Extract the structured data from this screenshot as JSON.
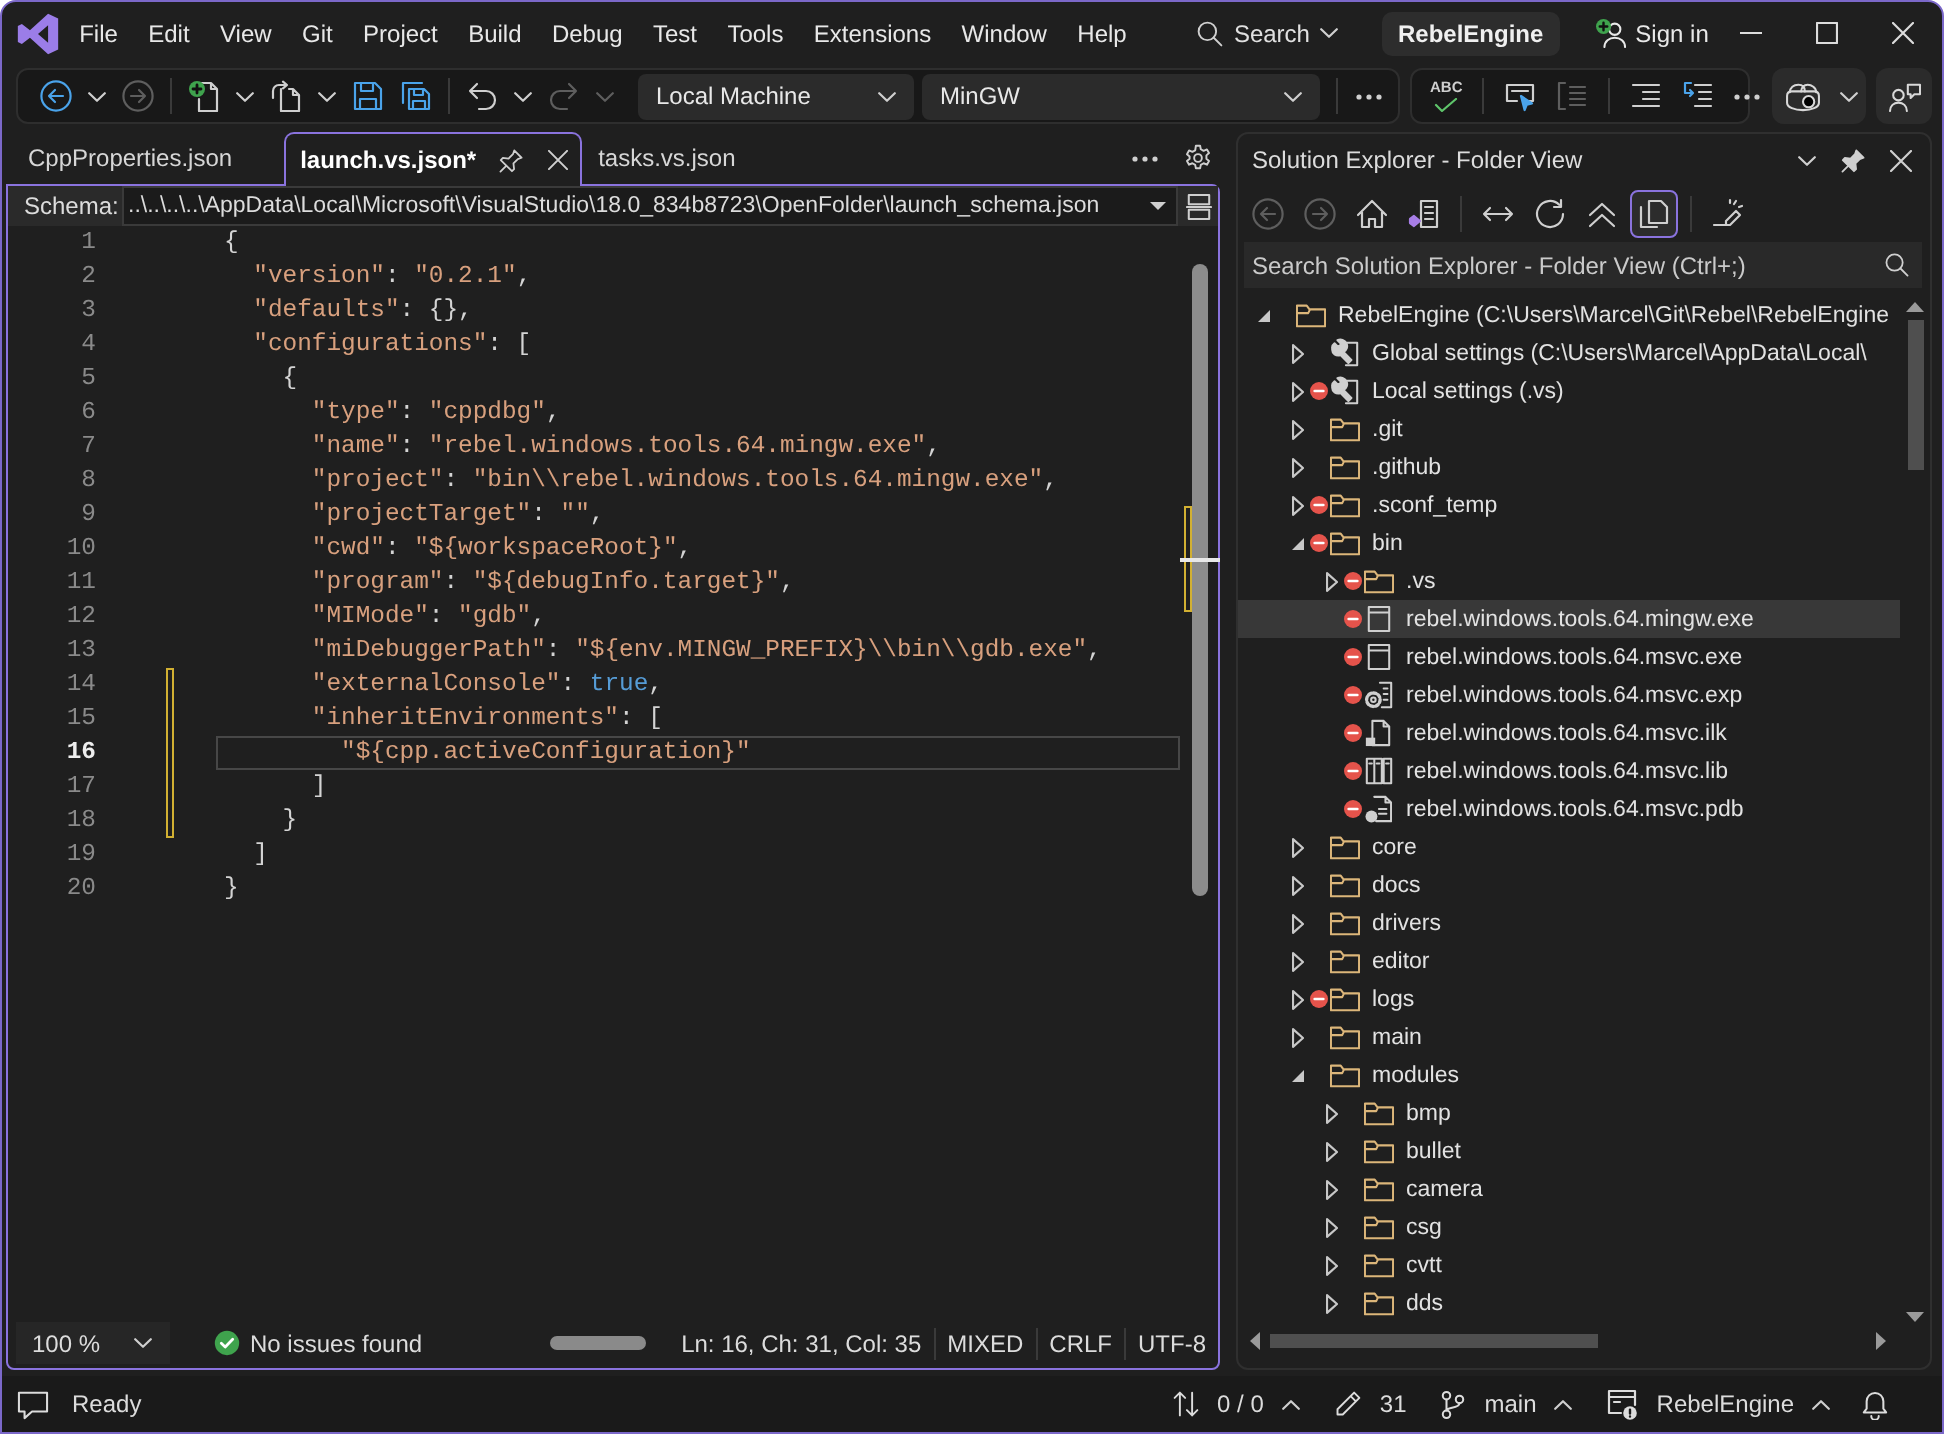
{
  "title_bar": {
    "menu": [
      "File",
      "Edit",
      "View",
      "Git",
      "Project",
      "Build",
      "Debug",
      "Test",
      "Tools",
      "Extensions",
      "Window",
      "Help"
    ],
    "search": "Search",
    "solution": "RebelEngine",
    "sign_in": "Sign in"
  },
  "toolbar": {
    "buttons": [
      {
        "kind": "back",
        "disabled": false
      },
      {
        "kind": "forward",
        "disabled": true
      },
      {
        "kind": "separator"
      },
      {
        "kind": "new",
        "disabled": false
      },
      {
        "kind": "open",
        "disabled": false
      },
      {
        "kind": "save",
        "disabled": false
      },
      {
        "kind": "save_all",
        "disabled": false
      },
      {
        "kind": "separator"
      },
      {
        "kind": "undo",
        "disabled": false
      },
      {
        "kind": "redo",
        "disabled": true
      }
    ],
    "target": "Local Machine",
    "configuration": "MinGW",
    "text_tools": [
      {
        "kind": "spelling",
        "label": "ABC",
        "disabled": false
      },
      {
        "kind": "separator"
      },
      {
        "kind": "comment",
        "disabled": false
      },
      {
        "kind": "uncomment",
        "disabled": true
      },
      {
        "kind": "separator"
      },
      {
        "kind": "indent",
        "disabled": false
      },
      {
        "kind": "wrap",
        "disabled": false
      }
    ]
  },
  "editor": {
    "tabs": [
      {
        "label": "CppProperties.json",
        "selected": false
      },
      {
        "label": "launch.vs.json*",
        "selected": true
      },
      {
        "label": "tasks.vs.json",
        "selected": false
      }
    ],
    "schema": {
      "label": "Schema:",
      "path": "..\\..\\..\\..\\AppData\\Local\\Microsoft\\VisualStudio\\18.0_834b8723\\OpenFolder\\launch_schema.json"
    },
    "lines": [
      {
        "number": "1",
        "current": false,
        "changed": false,
        "tokens": [
          {
            "kind": "punct",
            "text": "{"
          }
        ]
      },
      {
        "number": "2",
        "current": false,
        "changed": false,
        "tokens": [
          {
            "kind": "key",
            "text": "  \"version\""
          },
          {
            "kind": "punct",
            "text": ": "
          },
          {
            "kind": "string",
            "text": "\"0.2.1\""
          },
          {
            "kind": "punct",
            "text": ","
          }
        ]
      },
      {
        "number": "3",
        "current": false,
        "changed": false,
        "tokens": [
          {
            "kind": "key",
            "text": "  \"defaults\""
          },
          {
            "kind": "punct",
            "text": ": {},"
          }
        ]
      },
      {
        "number": "4",
        "current": false,
        "changed": false,
        "tokens": [
          {
            "kind": "key",
            "text": "  \"configurations\""
          },
          {
            "kind": "punct",
            "text": ": ["
          }
        ]
      },
      {
        "number": "5",
        "current": false,
        "changed": false,
        "tokens": [
          {
            "kind": "punct",
            "text": "    {"
          }
        ]
      },
      {
        "number": "6",
        "current": false,
        "changed": false,
        "tokens": [
          {
            "kind": "key",
            "text": "      \"type\""
          },
          {
            "kind": "punct",
            "text": ": "
          },
          {
            "kind": "string",
            "text": "\"cppdbg\""
          },
          {
            "kind": "punct",
            "text": ","
          }
        ]
      },
      {
        "number": "7",
        "current": false,
        "changed": false,
        "tokens": [
          {
            "kind": "key",
            "text": "      \"name\""
          },
          {
            "kind": "punct",
            "text": ": "
          },
          {
            "kind": "string",
            "text": "\"rebel.windows.tools.64.mingw.exe\""
          },
          {
            "kind": "punct",
            "text": ","
          }
        ]
      },
      {
        "number": "8",
        "current": false,
        "changed": false,
        "tokens": [
          {
            "kind": "key",
            "text": "      \"project\""
          },
          {
            "kind": "punct",
            "text": ": "
          },
          {
            "kind": "string",
            "text": "\"bin\\\\rebel.windows.tools.64.mingw.exe\""
          },
          {
            "kind": "punct",
            "text": ","
          }
        ]
      },
      {
        "number": "9",
        "current": false,
        "changed": false,
        "tokens": [
          {
            "kind": "key",
            "text": "      \"projectTarget\""
          },
          {
            "kind": "punct",
            "text": ": "
          },
          {
            "kind": "string",
            "text": "\"\""
          },
          {
            "kind": "punct",
            "text": ","
          }
        ]
      },
      {
        "number": "10",
        "current": false,
        "changed": false,
        "tokens": [
          {
            "kind": "key",
            "text": "      \"cwd\""
          },
          {
            "kind": "punct",
            "text": ": "
          },
          {
            "kind": "string",
            "text": "\"${workspaceRoot}\""
          },
          {
            "kind": "punct",
            "text": ","
          }
        ]
      },
      {
        "number": "11",
        "current": false,
        "changed": false,
        "tokens": [
          {
            "kind": "key",
            "text": "      \"program\""
          },
          {
            "kind": "punct",
            "text": ": "
          },
          {
            "kind": "string",
            "text": "\"${debugInfo.target}\""
          },
          {
            "kind": "punct",
            "text": ","
          }
        ]
      },
      {
        "number": "12",
        "current": false,
        "changed": false,
        "tokens": [
          {
            "kind": "key",
            "text": "      \"MIMode\""
          },
          {
            "kind": "punct",
            "text": ": "
          },
          {
            "kind": "string",
            "text": "\"gdb\""
          },
          {
            "kind": "punct",
            "text": ","
          }
        ]
      },
      {
        "number": "13",
        "current": false,
        "changed": false,
        "tokens": [
          {
            "kind": "key",
            "text": "      \"miDebuggerPath\""
          },
          {
            "kind": "punct",
            "text": ": "
          },
          {
            "kind": "string",
            "text": "\"${env.MINGW_PREFIX}\\\\bin\\\\gdb.exe\""
          },
          {
            "kind": "punct",
            "text": ","
          }
        ]
      },
      {
        "number": "14",
        "current": false,
        "changed": true,
        "tokens": [
          {
            "kind": "key",
            "text": "      \"externalConsole\""
          },
          {
            "kind": "punct",
            "text": ": "
          },
          {
            "kind": "literal",
            "text": "true"
          },
          {
            "kind": "punct",
            "text": ","
          }
        ]
      },
      {
        "number": "15",
        "current": false,
        "changed": true,
        "tokens": [
          {
            "kind": "key",
            "text": "      \"inheritEnvironments\""
          },
          {
            "kind": "punct",
            "text": ": ["
          }
        ]
      },
      {
        "number": "16",
        "current": true,
        "changed": true,
        "tokens": [
          {
            "kind": "string",
            "text": "        \"${cpp.activeConfiguration}\""
          }
        ]
      },
      {
        "number": "17",
        "current": false,
        "changed": true,
        "tokens": [
          {
            "kind": "punct",
            "text": "      ]"
          }
        ]
      },
      {
        "number": "18",
        "current": false,
        "changed": true,
        "tokens": [
          {
            "kind": "punct",
            "text": "    }"
          }
        ]
      },
      {
        "number": "19",
        "current": false,
        "changed": false,
        "tokens": [
          {
            "kind": "punct",
            "text": "  ]"
          }
        ]
      },
      {
        "number": "20",
        "current": false,
        "changed": false,
        "tokens": [
          {
            "kind": "punct",
            "text": "}"
          }
        ]
      }
    ],
    "status": {
      "zoom": "100 %",
      "issues": "No issues found",
      "position": "Ln: 16, Ch: 31, Col: 35",
      "indentation": "MIXED",
      "line_ending": "CRLF",
      "encoding": "UTF-8"
    }
  },
  "solution_explorer": {
    "title": "Solution Explorer - Folder View",
    "toolbar": [
      {
        "kind": "back",
        "disabled": true,
        "on": false
      },
      {
        "kind": "forward",
        "disabled": true,
        "on": false
      },
      {
        "kind": "home",
        "disabled": false,
        "on": false
      },
      {
        "kind": "switch_views",
        "disabled": false,
        "on": false
      },
      {
        "kind": "separator"
      },
      {
        "kind": "sync",
        "disabled": false,
        "on": false
      },
      {
        "kind": "refresh",
        "disabled": false,
        "on": false
      },
      {
        "kind": "collapse",
        "disabled": false,
        "on": false
      },
      {
        "kind": "show_all",
        "disabled": false,
        "on": true
      },
      {
        "kind": "separator"
      },
      {
        "kind": "properties",
        "disabled": false,
        "on": false
      }
    ],
    "search": {
      "placeholder": "Search Solution Explorer - Folder View (Ctrl+;)"
    },
    "tree": [
      {
        "label": "RebelEngine (C:\\Users\\Marcel\\Git\\Rebel\\RebelEngine",
        "kind": "folder",
        "expanded": true,
        "excluded": false,
        "selected": false,
        "children": [
          {
            "label": "Global settings (C:\\Users\\Marcel\\AppData\\Local\\",
            "kind": "settings",
            "expanded": false,
            "excluded": false,
            "selected": false
          },
          {
            "label": "Local settings (.vs)",
            "kind": "settings",
            "expanded": false,
            "excluded": true,
            "selected": false
          },
          {
            "label": ".git",
            "kind": "folder",
            "expanded": false,
            "excluded": false,
            "selected": false
          },
          {
            "label": ".github",
            "kind": "folder",
            "expanded": false,
            "excluded": false,
            "selected": false
          },
          {
            "label": ".sconf_temp",
            "kind": "folder",
            "expanded": false,
            "excluded": true,
            "selected": false
          },
          {
            "label": "bin",
            "kind": "folder",
            "expanded": true,
            "excluded": true,
            "selected": false,
            "children": [
              {
                "label": ".vs",
                "kind": "folder",
                "expanded": false,
                "excluded": true,
                "selected": false
              },
              {
                "label": "rebel.windows.tools.64.mingw.exe",
                "kind": "exe",
                "excluded": true,
                "selected": true
              },
              {
                "label": "rebel.windows.tools.64.msvc.exe",
                "kind": "exe",
                "excluded": true,
                "selected": false
              },
              {
                "label": "rebel.windows.tools.64.msvc.exp",
                "kind": "exp",
                "excluded": true,
                "selected": false
              },
              {
                "label": "rebel.windows.tools.64.msvc.ilk",
                "kind": "ilk",
                "excluded": true,
                "selected": false
              },
              {
                "label": "rebel.windows.tools.64.msvc.lib",
                "kind": "lib",
                "excluded": true,
                "selected": false
              },
              {
                "label": "rebel.windows.tools.64.msvc.pdb",
                "kind": "pdb",
                "excluded": true,
                "selected": false
              }
            ]
          },
          {
            "label": "core",
            "kind": "folder",
            "expanded": false,
            "excluded": false,
            "selected": false
          },
          {
            "label": "docs",
            "kind": "folder",
            "expanded": false,
            "excluded": false,
            "selected": false
          },
          {
            "label": "drivers",
            "kind": "folder",
            "expanded": false,
            "excluded": false,
            "selected": false
          },
          {
            "label": "editor",
            "kind": "folder",
            "expanded": false,
            "excluded": false,
            "selected": false
          },
          {
            "label": "logs",
            "kind": "folder",
            "expanded": false,
            "excluded": true,
            "selected": false
          },
          {
            "label": "main",
            "kind": "folder",
            "expanded": false,
            "excluded": false,
            "selected": false
          },
          {
            "label": "modules",
            "kind": "folder",
            "expanded": true,
            "excluded": false,
            "selected": false,
            "children": [
              {
                "label": "bmp",
                "kind": "folder",
                "expanded": false,
                "excluded": false,
                "selected": false
              },
              {
                "label": "bullet",
                "kind": "folder",
                "expanded": false,
                "excluded": false,
                "selected": false
              },
              {
                "label": "camera",
                "kind": "folder",
                "expanded": false,
                "excluded": false,
                "selected": false
              },
              {
                "label": "csg",
                "kind": "folder",
                "expanded": false,
                "excluded": false,
                "selected": false
              },
              {
                "label": "cvtt",
                "kind": "folder",
                "expanded": false,
                "excluded": false,
                "selected": false
              },
              {
                "label": "dds",
                "kind": "folder",
                "expanded": false,
                "excluded": false,
                "selected": false
              }
            ]
          }
        ]
      }
    ]
  },
  "status_bar": {
    "message": "Ready",
    "sync": "0 / 0",
    "changes": "31",
    "branch": "main",
    "repository": "RebelEngine"
  }
}
